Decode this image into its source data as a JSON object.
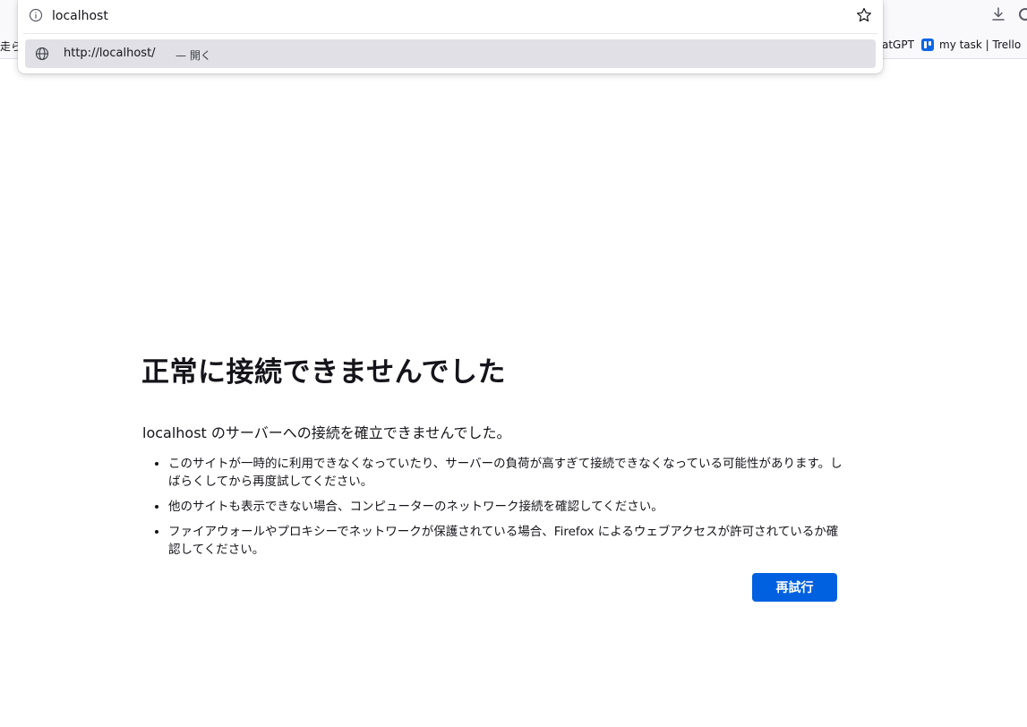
{
  "url_bar": {
    "value": "localhost"
  },
  "suggestion": {
    "url": "http://localhost/",
    "action": "— 開く"
  },
  "bookmarks": {
    "left_clipped": "走ら",
    "chatgpt_clipped": "atGPT",
    "trello": "my task | Trello"
  },
  "error_page": {
    "title": "正常に接続できませんでした",
    "intro": "localhost のサーバーへの接続を確立できませんでした。",
    "bullets": [
      "このサイトが一時的に利用できなくなっていたり、サーバーの負荷が高すぎて接続できなくなっている可能性があります。しばらくしてから再度試してください。",
      "他のサイトも表示できない場合、コンピューターのネットワーク接続を確認してください。",
      "ファイアウォールやプロキシーでネットワークが保護されている場合、Firefox によるウェブアクセスが許可されているか確認してください。"
    ],
    "retry_button": "再試行"
  },
  "colors": {
    "accent": "#0061e0",
    "suggestion_highlight": "#e0e0e6",
    "chrome_background": "#f9f9fb"
  },
  "icons": [
    "info-icon",
    "star-icon",
    "globe-icon",
    "download-icon",
    "trello-icon"
  ]
}
